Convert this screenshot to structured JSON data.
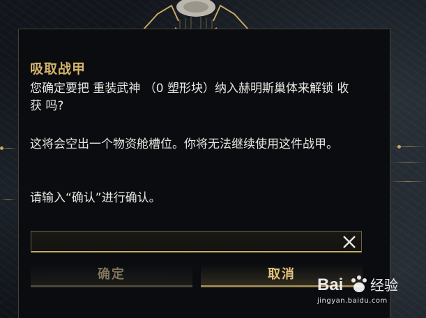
{
  "dialog": {
    "title": "吸取战甲",
    "message_line1": "您确定要把 重装武神 （0 塑形块）纳入赫明斯巢体来解锁 收获 吗?",
    "message_line2": "这将会空出一个物资舱槽位。你将无法继续使用这件战甲。",
    "message_line3": "请输入“确认”进行确认。",
    "input": {
      "value": "",
      "placeholder": ""
    },
    "clear_icon": "close-icon",
    "confirm_label": "确定",
    "cancel_label": "取消"
  },
  "watermark": {
    "brand_text": "Bai 经验",
    "url": "jingyan.baidu.com"
  },
  "colors": {
    "accent_gold": "#d5b46a",
    "text": "#e8e6e1",
    "disabled_text": "#7f745c",
    "panel_bg": "#0a0c10"
  }
}
